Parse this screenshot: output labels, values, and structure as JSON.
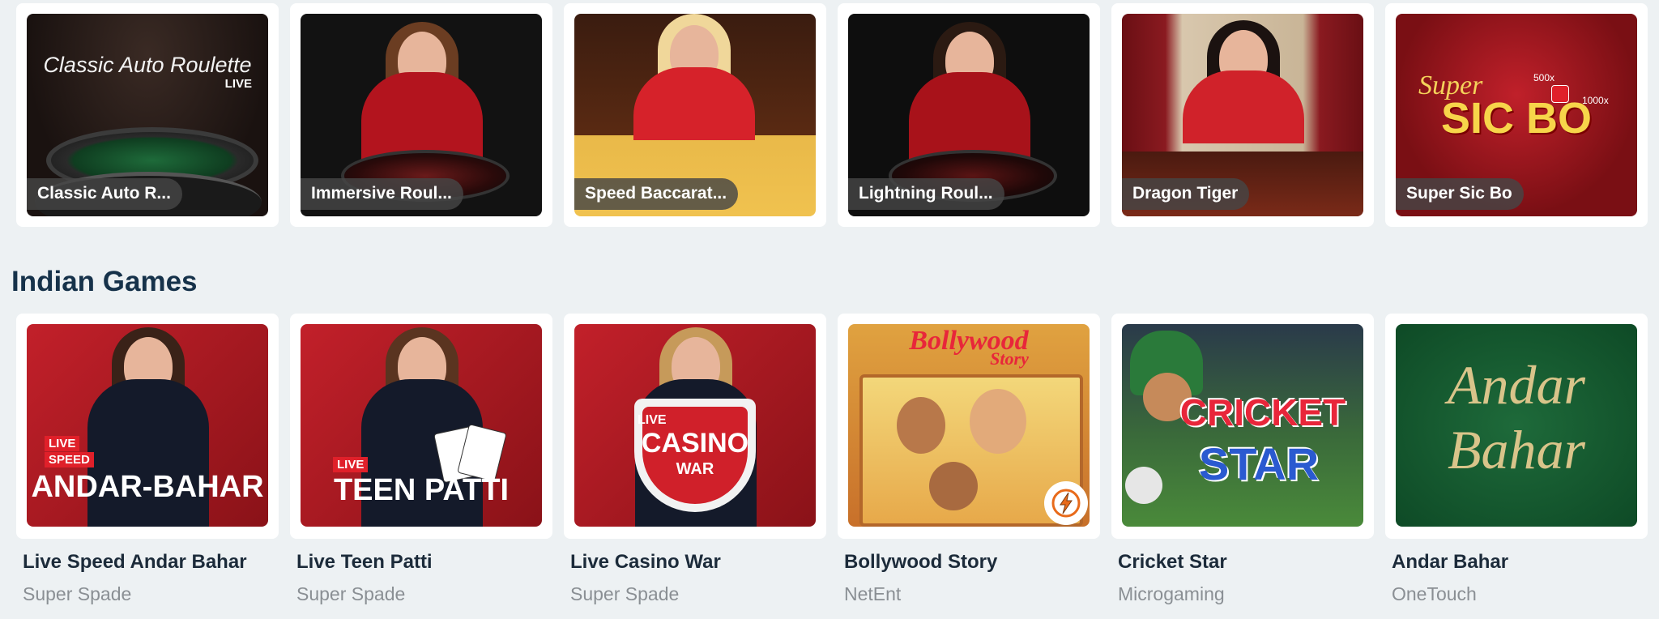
{
  "top_row": {
    "games": [
      {
        "label": "Classic Auto R...",
        "art_title": "Classic Auto Roulette",
        "art_badge": "LIVE"
      },
      {
        "label": "Immersive Roul..."
      },
      {
        "label": "Speed Baccarat..."
      },
      {
        "label": "Lightning Roul..."
      },
      {
        "label": "Dragon Tiger"
      },
      {
        "label": "Super Sic Bo",
        "art_word1": "Super",
        "art_word2": "SIC BO",
        "art_mult1": "500x",
        "art_mult2": "1000x"
      }
    ]
  },
  "indian_games": {
    "title": "Indian Games",
    "games": [
      {
        "name": "Live Speed Andar Bahar",
        "provider": "Super Spade",
        "art_live": "LIVE",
        "art_speed": "SPEED",
        "art_title": "ANDAR-BAHAR"
      },
      {
        "name": "Live Teen Patti",
        "provider": "Super Spade",
        "art_live": "LIVE",
        "art_title": "TEEN PATTI"
      },
      {
        "name": "Live Casino War",
        "provider": "Super Spade",
        "art_live": "LIVE",
        "art_title": "CASINO",
        "art_sub": "WAR"
      },
      {
        "name": "Bollywood Story",
        "provider": "NetEnt",
        "art_title": "Bollywood",
        "art_sub": "Story",
        "badge_icon": "lightning-icon"
      },
      {
        "name": "Cricket Star",
        "provider": "Microgaming",
        "art_title": "CRICKET",
        "art_sub": "STAR"
      },
      {
        "name": "Andar Bahar",
        "provider": "OneTouch",
        "art_title": "Andar",
        "art_sub": "Bahar"
      }
    ]
  },
  "colors": {
    "page_bg": "#edf1f3",
    "title": "#16324a",
    "provider": "#8a8f94",
    "pill_bg": "#464646"
  }
}
